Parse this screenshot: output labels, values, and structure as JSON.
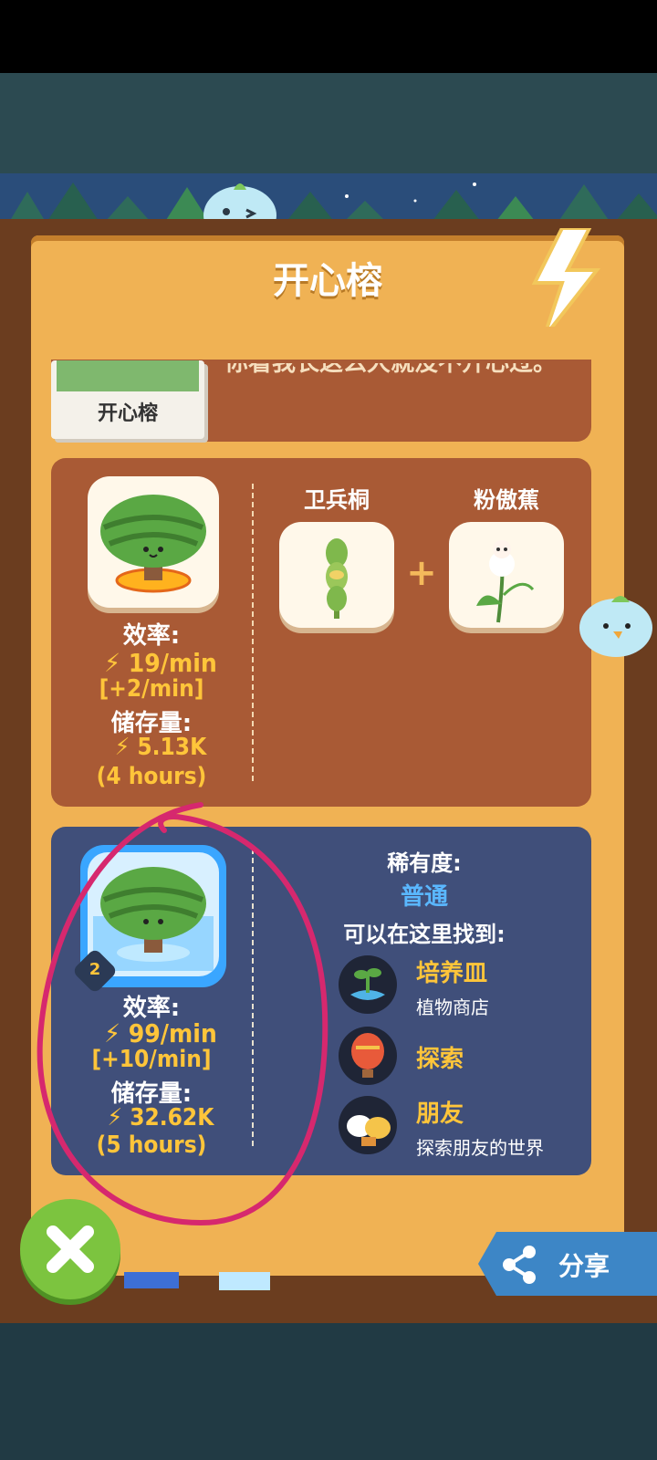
{
  "title": "开心榕",
  "top_card": {
    "image_label": "开心榕",
    "partial_text": "你看我长这么大就没不开心过。"
  },
  "stage1": {
    "efficiency_label": "效率:",
    "efficiency_value": "19/min",
    "efficiency_bonus": "[+2/min]",
    "storage_label": "储存量:",
    "storage_value": "5.13K",
    "storage_time": "(4 hours)",
    "recipe": [
      {
        "label": "卫兵桐"
      },
      {
        "label": "粉傲蕉"
      }
    ],
    "plus": "+"
  },
  "stage2": {
    "level_badge": "2",
    "efficiency_label": "效率:",
    "efficiency_value": "99/min",
    "efficiency_bonus": "[+10/min]",
    "storage_label": "储存量:",
    "storage_value": "32.62K",
    "storage_time": "(5 hours)",
    "rarity_label": "稀有度:",
    "rarity_value": "普通",
    "find_here": "可以在这里找到:",
    "sources": [
      {
        "title": "培养皿",
        "subtitle": "植物商店",
        "icon": "seedling-icon"
      },
      {
        "title": "探索",
        "subtitle": "",
        "icon": "hot-air-balloon-icon"
      },
      {
        "title": "朋友",
        "subtitle": "探索朋友的世界",
        "icon": "friends-icon"
      }
    ]
  },
  "share_label": "分享",
  "colors": {
    "panel": "#f0b254",
    "card_brown": "#a95a35",
    "card_navy": "#404f7a",
    "accent_yellow": "#ffc53a",
    "rarity_blue": "#5ab7ff",
    "share_blue": "#3d86c6",
    "close_green": "#7cc43f",
    "annotation_magenta": "#d6286e"
  }
}
